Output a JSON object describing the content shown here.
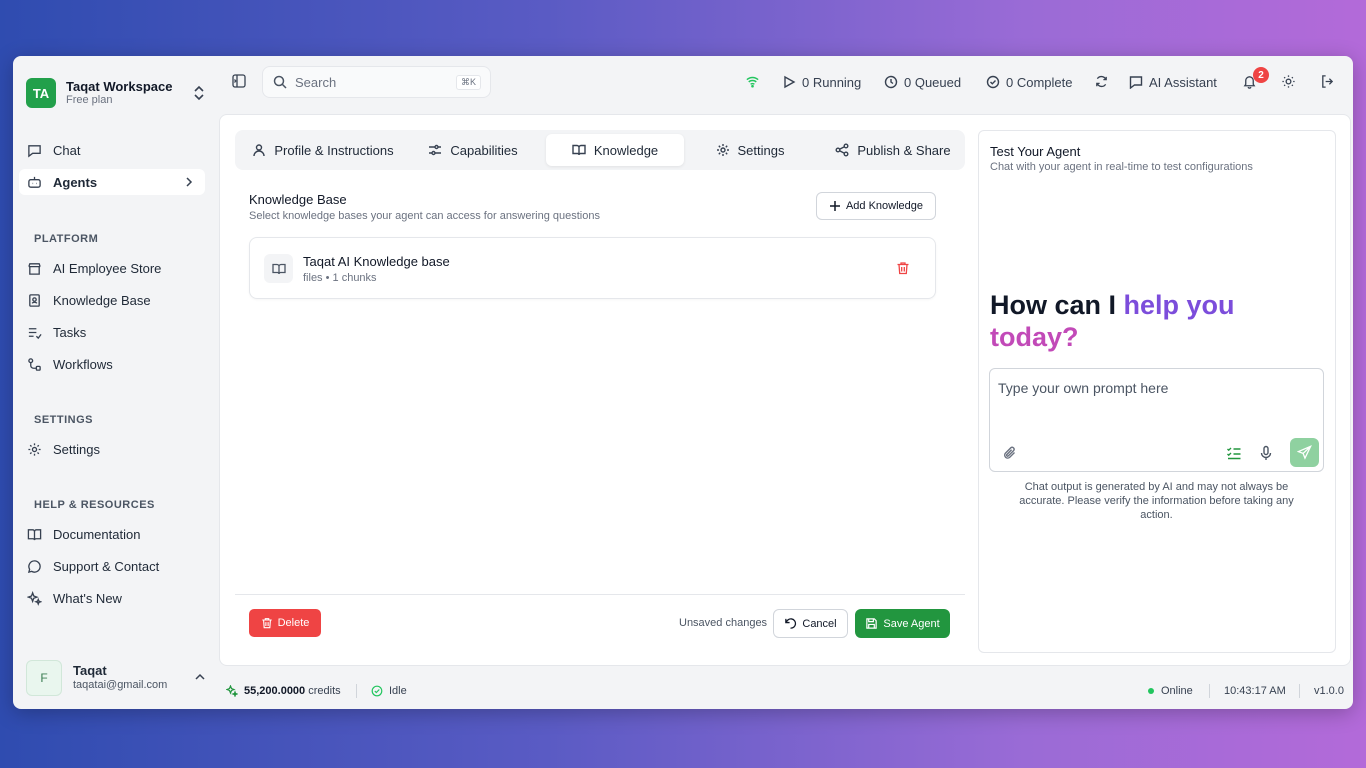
{
  "workspace": {
    "initials": "TA",
    "name": "Taqat Workspace",
    "plan": "Free plan"
  },
  "nav": {
    "chat": "Chat",
    "agents": "Agents",
    "platform_label": "PLATFORM",
    "platform": [
      "AI Employee Store",
      "Knowledge Base",
      "Tasks",
      "Workflows"
    ],
    "settings_label": "SETTINGS",
    "settings": "Settings",
    "help_label": "HELP & RESOURCES",
    "help": [
      "Documentation",
      "Support & Contact",
      "What's New"
    ]
  },
  "user": {
    "initial": "F",
    "name": "Taqat",
    "email": "taqatai@gmail.com"
  },
  "topbar": {
    "search_placeholder": "Search",
    "search_shortcut": "⌘K",
    "running": "0 Running",
    "queued": "0 Queued",
    "complete": "0 Complete",
    "assistant": "AI Assistant",
    "notifications": "2"
  },
  "tabs": [
    "Profile & Instructions",
    "Capabilities",
    "Knowledge",
    "Settings",
    "Publish & Share"
  ],
  "active_tab": "Knowledge",
  "knowledge": {
    "title": "Knowledge Base",
    "subtitle": "Select knowledge bases your agent can access for answering questions",
    "add_button": "Add Knowledge",
    "items": [
      {
        "name": "Taqat AI Knowledge base",
        "meta": "files • 1 chunks"
      }
    ]
  },
  "actions": {
    "delete": "Delete",
    "unsaved": "Unsaved changes",
    "cancel": "Cancel",
    "save": "Save Agent"
  },
  "test_panel": {
    "title": "Test Your Agent",
    "subtitle": "Chat with your agent in real-time to test configurations",
    "hero_1": "How can I ",
    "hero_2": "help you",
    "hero_3": "today?",
    "prompt_placeholder": "Type your own prompt here",
    "disclaimer": "Chat output is generated by AI and may not always be accurate. Please verify the information before taking any action."
  },
  "footer": {
    "credits_value": "55,200.0000",
    "credits_label": "credits",
    "status": "Idle",
    "online": "Online",
    "time": "10:43:17 AM",
    "version": "v1.0.0"
  },
  "colors": {
    "brand_green": "#22a04b",
    "save_green": "#22963f",
    "danger_red": "#ef4444",
    "hero_purple": "#7c4ddb",
    "hero_pink": "#c24ab8",
    "wifi_green": "#22c55e"
  }
}
